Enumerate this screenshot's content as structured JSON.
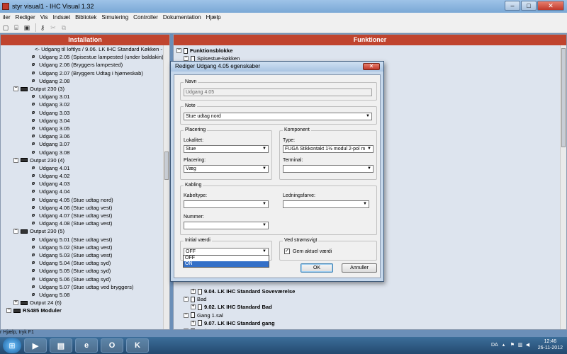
{
  "window": {
    "title": "styr visual1 - IHC Visual 1.32",
    "controls": {
      "minimize": "–",
      "maximize": "□",
      "close": "✕"
    }
  },
  "menu": [
    "iler",
    "Rediger",
    "Vis",
    "Indsæt",
    "Bibliotek",
    "Simulering",
    "Controller",
    "Dokumentation",
    "Hjælp"
  ],
  "toolbar": [
    {
      "icon": "new-icon",
      "glyph": "▢"
    },
    {
      "icon": "open-icon",
      "glyph": "⌸"
    },
    {
      "icon": "save-icon",
      "glyph": "▣"
    },
    {
      "icon": "key-icon",
      "glyph": "⚷"
    },
    {
      "icon": "cut-icon",
      "glyph": "✂"
    },
    {
      "icon": "copy-icon",
      "glyph": "⧉"
    }
  ],
  "left_panel": {
    "header": "Installation",
    "rows": [
      {
        "indent": 48,
        "type": "link",
        "text": "<- Udgang til loftlys / 9.06. LK IHC Standard Køkken -"
      },
      {
        "indent": 42,
        "type": "udg",
        "text": "Udgang 2.05 (Spisestue lampested (under baldakin))"
      },
      {
        "indent": 42,
        "type": "udg",
        "text": "Udgang 2.06 (Bryggers lampested)"
      },
      {
        "indent": 42,
        "type": "udg",
        "text": "Udgang 2.07 (Bryggers Udtag i hjørneskab)"
      },
      {
        "indent": 42,
        "type": "udg",
        "text": "Udgang 2.08"
      },
      {
        "indent": 18,
        "type": "out",
        "text": "Output 230 (3)"
      },
      {
        "indent": 42,
        "type": "udg",
        "text": "Udgang 3.01"
      },
      {
        "indent": 42,
        "type": "udg",
        "text": "Udgang 3.02"
      },
      {
        "indent": 42,
        "type": "udg",
        "text": "Udgang 3.03"
      },
      {
        "indent": 42,
        "type": "udg",
        "text": "Udgang 3.04"
      },
      {
        "indent": 42,
        "type": "udg",
        "text": "Udgang 3.05"
      },
      {
        "indent": 42,
        "type": "udg",
        "text": "Udgang 3.06"
      },
      {
        "indent": 42,
        "type": "udg",
        "text": "Udgang 3.07"
      },
      {
        "indent": 42,
        "type": "udg",
        "text": "Udgang 3.08"
      },
      {
        "indent": 18,
        "type": "out",
        "text": "Output 230 (4)"
      },
      {
        "indent": 42,
        "type": "udg",
        "text": "Udgang 4.01"
      },
      {
        "indent": 42,
        "type": "udg",
        "text": "Udgang 4.02"
      },
      {
        "indent": 42,
        "type": "udg",
        "text": "Udgang 4.03"
      },
      {
        "indent": 42,
        "type": "udg",
        "text": "Udgang 4.04"
      },
      {
        "indent": 42,
        "type": "udg",
        "text": "Udgang 4.05 (Stue udtag nord)"
      },
      {
        "indent": 42,
        "type": "udg",
        "text": "Udgang 4.06 (Stue udtag vest)"
      },
      {
        "indent": 42,
        "type": "udg",
        "text": "Udgang 4.07 (Stue udtag vest)"
      },
      {
        "indent": 42,
        "type": "udg",
        "text": "Udgang 4.08 (Stue udtag vest)"
      },
      {
        "indent": 18,
        "type": "out",
        "text": "Output 230 (5)"
      },
      {
        "indent": 42,
        "type": "udg",
        "text": "Udgang 5.01 (Stue udtag vest)"
      },
      {
        "indent": 42,
        "type": "udg",
        "text": "Udgang 5.02 (Stue udtag vest)"
      },
      {
        "indent": 42,
        "type": "udg",
        "text": "Udgang 5.03 (Stue udtag vest)"
      },
      {
        "indent": 42,
        "type": "udg",
        "text": "Udgang 5.04 (Stue udtag syd)"
      },
      {
        "indent": 42,
        "type": "udg",
        "text": "Udgang 5.05 (Stue udtag syd)"
      },
      {
        "indent": 42,
        "type": "udg",
        "text": "Udgang 5.06 (Stue udtag syd)"
      },
      {
        "indent": 42,
        "type": "udg",
        "text": "Udgang 5.07 (Stue udtag ved bryggers)"
      },
      {
        "indent": 42,
        "type": "udg",
        "text": "Udgang 5.08"
      },
      {
        "indent": 18,
        "type": "out-collapsed",
        "text": "Output 24 (6)"
      },
      {
        "indent": 8,
        "type": "rs485",
        "text": "RS485 Moduler"
      }
    ]
  },
  "right_panel": {
    "header": "Funktioner",
    "rows_top": [
      {
        "indent": 4,
        "toggle": "⊟",
        "text": "Funktionsblokke",
        "bold": true
      },
      {
        "indent": 14,
        "toggle": "⊟",
        "text": "Spisestue-køkken",
        "bold": false
      }
    ],
    "rows_bottom": [
      {
        "indent": 24,
        "toggle": "⊞",
        "text": "9.04. LK IHC Standard Soveværelse",
        "bold": true
      },
      {
        "indent": 14,
        "toggle": "⊟",
        "text": "Bad",
        "bold": false
      },
      {
        "indent": 24,
        "toggle": "⊞",
        "text": "9.02. LK IHC Standard Bad",
        "bold": true
      },
      {
        "indent": 14,
        "toggle": "⊟",
        "text": "Gang 1.sal",
        "bold": false
      },
      {
        "indent": 24,
        "toggle": "⊞",
        "text": "9.07. LK IHC Standard gang",
        "bold": true
      },
      {
        "indent": 14,
        "toggle": "⊟",
        "text": "Bad 1.sal",
        "bold": false
      }
    ]
  },
  "dialog": {
    "title": "Rediger Udgang 4.05 egenskaber",
    "close": "✕",
    "navn_label": "Navn",
    "navn_value": "Udgang 4.05",
    "note_label": "Note",
    "note_value": "Stue udtag nord",
    "placering_group": "Placering",
    "lokalitet_label": "Lokalitet:",
    "lokalitet_value": "Stue",
    "placering_label": "Placering:",
    "placering_value": "Væg",
    "komponent_group": "Komponent",
    "type_label": "Type:",
    "type_value": "FUGA Stikkontakt 1½ modul 2-pol m",
    "terminal_label": "Terminal:",
    "terminal_value": "",
    "kabling_group": "Kabling",
    "kabeltype_label": "Kabeltype:",
    "kabeltype_value": "",
    "nummer_label": "Nummer:",
    "nummer_value": "",
    "ledningsfarve_label": "Ledningsfarve:",
    "ledningsfarve_value": "",
    "initial_group": "Initial værdi",
    "initial_value": "OFF",
    "initial_options": [
      "OFF",
      "ON"
    ],
    "initial_highlighted": "ON",
    "stroemsvigt_group": "Ved strømsvigt",
    "gem_label": "Gem aktuel værdi",
    "gem_checked": true,
    "ok_label": "OK",
    "annuller_label": "Annuller"
  },
  "status_hint": "r Hjælp, tryk F1",
  "taskbar": {
    "apps": [
      {
        "icon": "media-player-icon",
        "glyph": "▶"
      },
      {
        "icon": "folder-icon",
        "glyph": "▤"
      },
      {
        "icon": "ie-icon",
        "glyph": "e"
      },
      {
        "icon": "outlook-icon",
        "glyph": "O"
      },
      {
        "icon": "ihc-icon",
        "glyph": "K"
      }
    ],
    "lang": "DA",
    "time": "12:46",
    "date": "26-11-2012"
  },
  "colors": {
    "panel_header": "#c0442e",
    "panel_body": "#dde4ee",
    "selection": "#3470c8"
  }
}
